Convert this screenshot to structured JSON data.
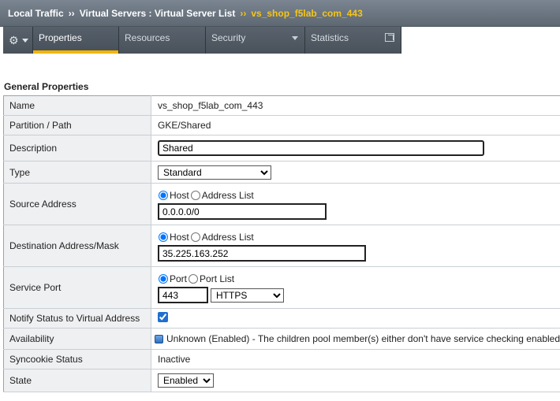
{
  "breadcrumb": {
    "sep": "››",
    "item1": "Local Traffic",
    "item2": "Virtual Servers : Virtual Server List",
    "current": "vs_shop_f5lab_com_443"
  },
  "tabs": [
    {
      "label": "Properties"
    },
    {
      "label": "Resources"
    },
    {
      "label": "Security"
    },
    {
      "label": "Statistics"
    }
  ],
  "section_title": "General Properties",
  "labels": {
    "name": "Name",
    "partition": "Partition / Path",
    "description": "Description",
    "type": "Type",
    "source": "Source Address",
    "destination": "Destination Address/Mask",
    "service_port": "Service Port",
    "notify": "Notify Status to Virtual Address",
    "availability": "Availability",
    "syncookie": "Syncookie Status",
    "state": "State"
  },
  "values": {
    "name": "vs_shop_f5lab_com_443",
    "partition": "GKE/Shared",
    "description": "Shared",
    "type": "Standard",
    "source_host_label": "Host",
    "source_list_label": "Address List",
    "source_address": "0.0.0.0/0",
    "dest_host_label": "Host",
    "dest_list_label": "Address List",
    "dest_address": "35.225.163.252",
    "port_label": "Port",
    "port_list_label": "Port List",
    "port": "443",
    "port_service": "HTTPS",
    "availability": "Unknown (Enabled) - The children pool member(s) either don't have service checking enabled",
    "syncookie": "Inactive",
    "state": "Enabled"
  },
  "colors": {
    "accent_tab_underline": "#f2b705",
    "breadcrumb_current": "#f5c518",
    "availability_icon": "#2d6fc0"
  }
}
